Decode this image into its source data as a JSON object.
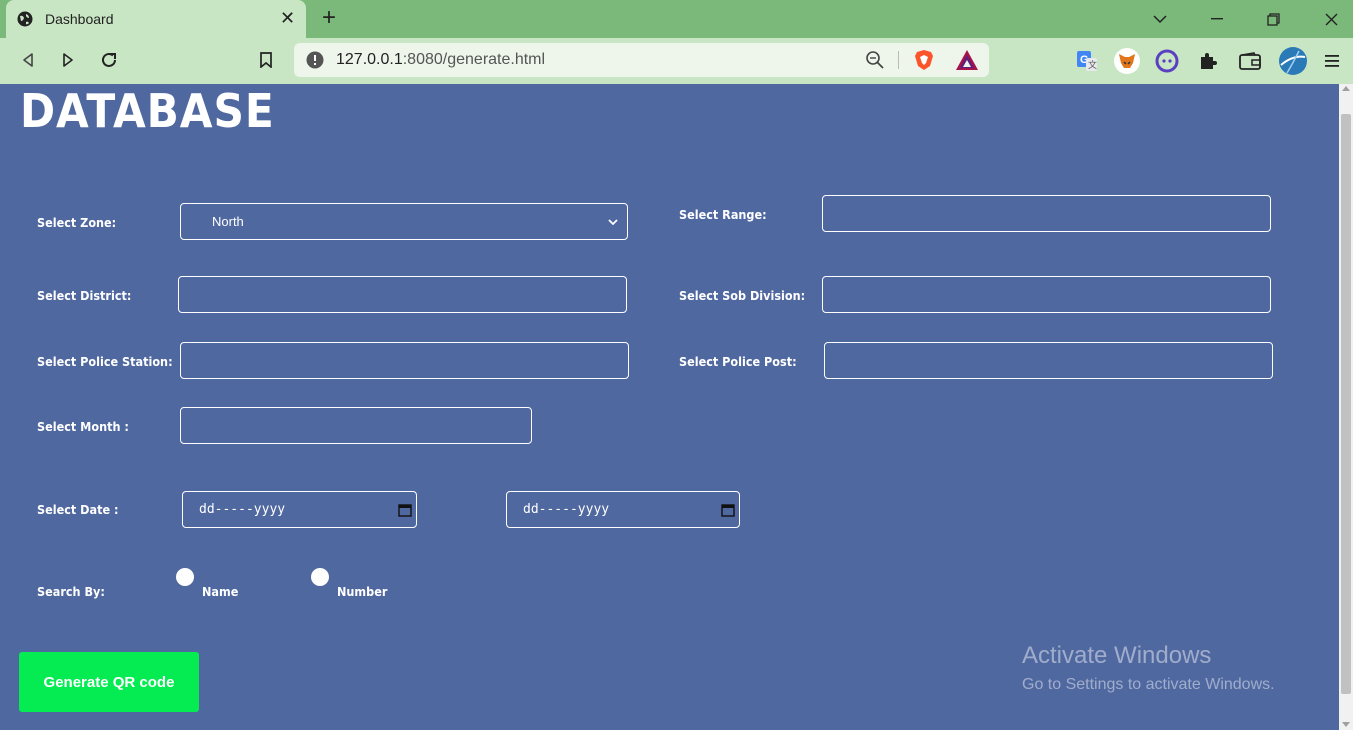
{
  "browser": {
    "tab_title": "Dashboard",
    "url_host": "127.0.0.1",
    "url_rest": ":8080/generate.html"
  },
  "page": {
    "title": "DATABASE",
    "labels": {
      "zone": "Select Zone:",
      "range": "Select Range:",
      "district": "Select District:",
      "sub_division": "Select Sob Division:",
      "police_station": "Select Police Station:",
      "police_post": "Select Police Post:",
      "month": "Select Month :",
      "date": "Select Date :",
      "search_by": "Search By:"
    },
    "zone_value": "North",
    "date_from_placeholder": "dd-----yyyy",
    "date_to_placeholder": "dd-----yyyy",
    "radio_name": "Name",
    "radio_number": "Number",
    "generate_button": "Generate QR code"
  },
  "watermark": {
    "title": "Activate Windows",
    "subtitle": "Go to Settings to activate Windows."
  }
}
